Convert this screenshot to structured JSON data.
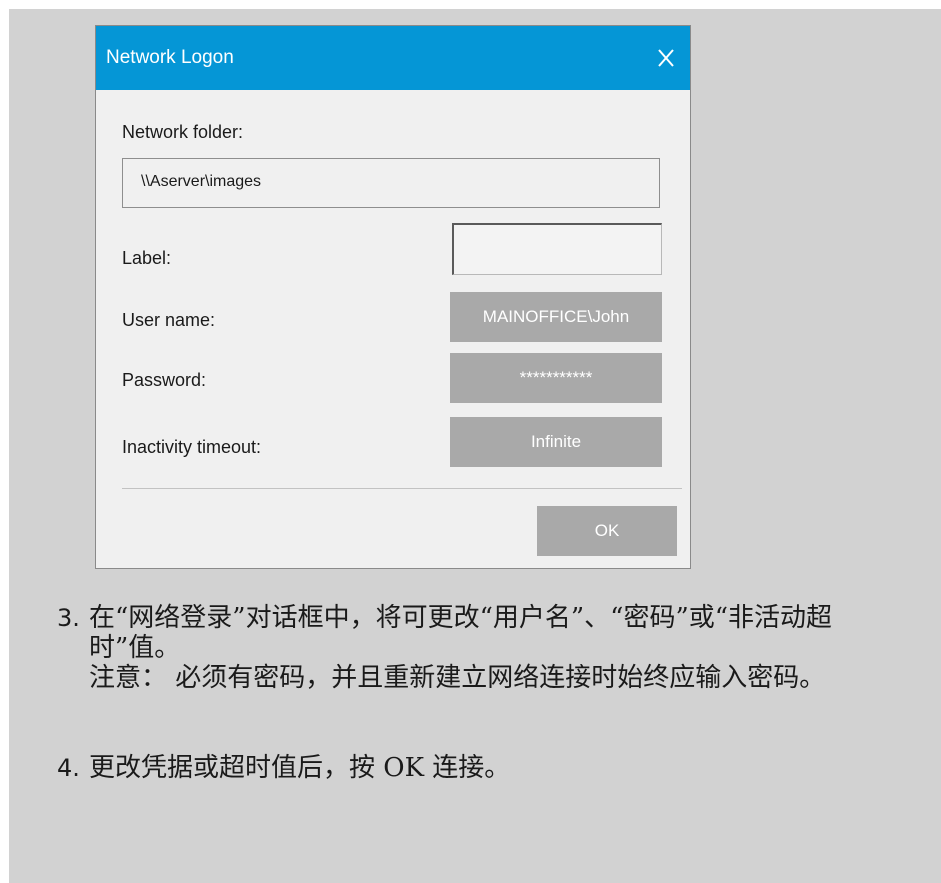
{
  "dialog": {
    "title": "Network Logon",
    "close_icon": "close-icon",
    "network_folder_label": "Network folder:",
    "network_folder_value": "\\\\Aserver\\images",
    "label_label": "Label:",
    "label_value": "",
    "user_name_label": "User name:",
    "user_name_value": "MAINOFFICE\\John",
    "password_label": "Password:",
    "password_value": "***********",
    "inactivity_timeout_label": "Inactivity timeout:",
    "inactivity_timeout_value": "Infinite",
    "ok_label": "OK"
  },
  "instructions": {
    "step3": {
      "number": "3.",
      "text": "在“网络登录”对话框中，将可更改“用户名”、“密码”或“非活动超时”值。",
      "note": "注意： 必须有密码，并且重新建立网络连接时始终应输入密码。"
    },
    "step4": {
      "number": "4.",
      "text": "更改凭据或超时值后，按 OK 连接。"
    }
  },
  "colors": {
    "titlebar": "#0596d6",
    "dialog_bg": "#f0f0f0",
    "field_button": "#a9a9a9",
    "page_panel": "#d2d2d2"
  }
}
